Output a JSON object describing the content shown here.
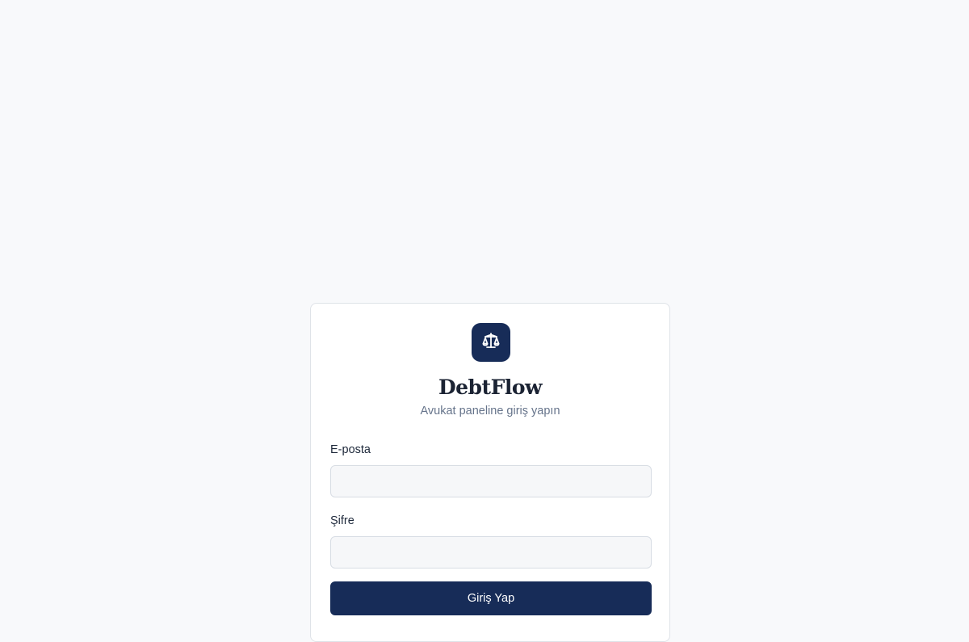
{
  "brand": {
    "logo_icon": "scale-icon",
    "name": "DebtFlow",
    "subtitle": "Avukat paneline giriş yapın"
  },
  "form": {
    "email": {
      "label": "E-posta",
      "value": "",
      "placeholder": ""
    },
    "password": {
      "label": "Şifre",
      "value": "",
      "placeholder": ""
    },
    "submit_label": "Giriş Yap"
  },
  "colors": {
    "page_background": "#f8f9fb",
    "primary": "#172c58",
    "muted_text": "#66748b",
    "input_background": "#f6f7f9"
  }
}
